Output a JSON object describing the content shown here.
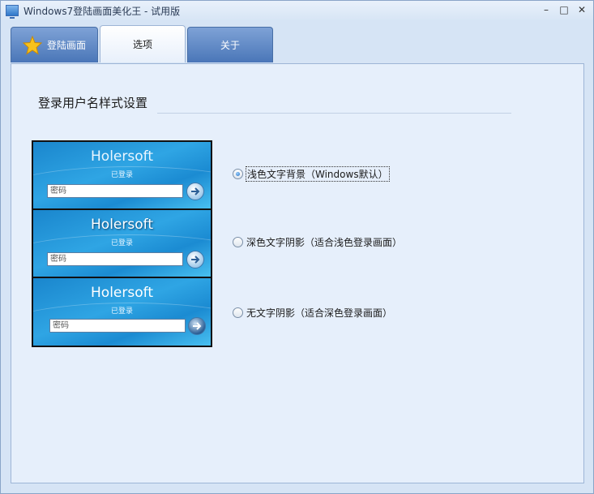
{
  "window": {
    "title": "Windows7登陆画面美化王 - 试用版",
    "controls": {
      "minimize": "–",
      "maximize": "□",
      "close": "✕"
    }
  },
  "tabs": [
    {
      "label": "登陆画面",
      "icon": "star-icon",
      "active": false
    },
    {
      "label": "选项",
      "active": true
    },
    {
      "label": "关于",
      "active": false
    }
  ],
  "section": {
    "title": "登录用户名样式设置"
  },
  "preview": {
    "cards": [
      {
        "username": "Holersoft",
        "status": "已登录",
        "password_placeholder": "密码"
      },
      {
        "username": "Holersoft",
        "status": "已登录",
        "password_placeholder": "密码"
      },
      {
        "username": "Holersoft",
        "status": "已登录",
        "password_placeholder": "密码"
      }
    ]
  },
  "options": [
    {
      "label": "浅色文字背景（Windows默认）",
      "checked": true
    },
    {
      "label": "深色文字阴影（适合浅色登录画面）",
      "checked": false
    },
    {
      "label": "无文字阴影（适合深色登录画面）",
      "checked": false
    }
  ],
  "colors": {
    "tab_inactive": "#4a76b8",
    "panel_bg": "#e6effb",
    "login_blue": "#1a86cd"
  }
}
